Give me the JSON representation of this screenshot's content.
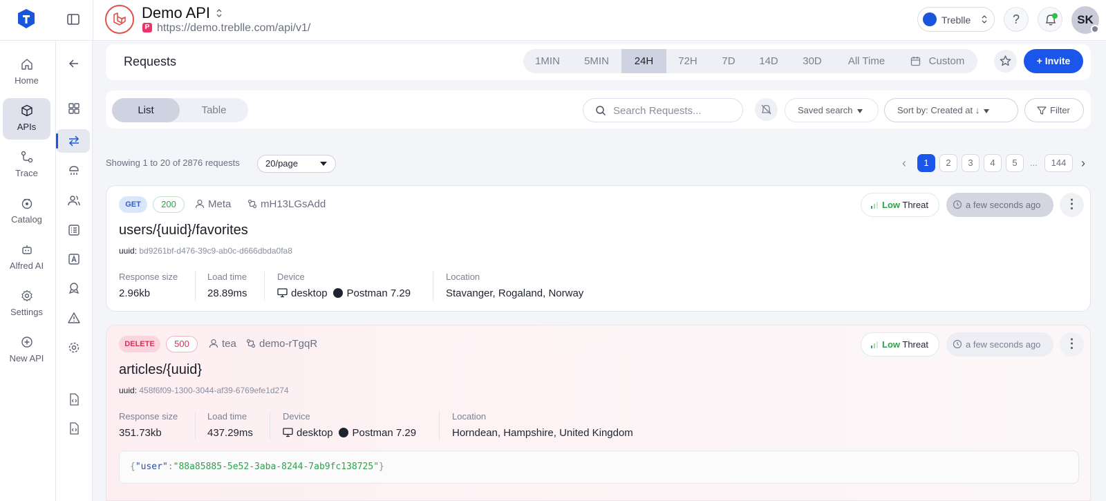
{
  "header": {
    "api_title": "Demo API",
    "api_url_badge": "P",
    "api_url": "https://demo.treblle.com/api/v1/",
    "workspace_name": "Treblle",
    "help_label": "?",
    "avatar_initials": "SK"
  },
  "sidebar": {
    "items": [
      {
        "label": "Home",
        "icon": "home-icon"
      },
      {
        "label": "APIs",
        "icon": "cube-icon"
      },
      {
        "label": "Trace",
        "icon": "trace-icon"
      },
      {
        "label": "Catalog",
        "icon": "catalog-icon"
      },
      {
        "label": "Alfred AI",
        "icon": "robot-icon"
      },
      {
        "label": "Settings",
        "icon": "gear-icon"
      },
      {
        "label": "New API",
        "icon": "plus-circle-icon"
      }
    ]
  },
  "requests": {
    "title": "Requests",
    "ranges": [
      "1MIN",
      "5MIN",
      "24H",
      "72H",
      "7D",
      "14D",
      "30D",
      "All Time",
      "Custom"
    ],
    "active_range": "24H",
    "invite_label": "+ Invite"
  },
  "toolbar": {
    "view_list": "List",
    "view_table": "Table",
    "search_placeholder": "Search Requests...",
    "saved_search": "Saved search",
    "sort_label": "Sort by: Created at ↓",
    "filter_label": "Filter"
  },
  "paging": {
    "showing": "Showing 1 to 20 of 2876 requests",
    "per_page": "20/page",
    "pages": [
      "1",
      "2",
      "3",
      "4",
      "5"
    ],
    "ellipsis": "...",
    "last_page": "144",
    "prev": "‹",
    "next": "›"
  },
  "cards": [
    {
      "method": "GET",
      "status": "200",
      "user": "Meta",
      "customer": "mH13LGsAdd",
      "endpoint": "users/{uuid}/favorites",
      "uuid_key": "uuid:",
      "uuid": "bd9261bf-d476-39c9-ab0c-d666dbda0fa8",
      "threat_level": "Low",
      "threat_word": "Threat",
      "time": "a few seconds ago",
      "response_size_label": "Response size",
      "response_size": "2.96kb",
      "load_time_label": "Load time",
      "load_time": "28.89ms",
      "device_label": "Device",
      "device": "desktop",
      "client": "Postman 7.29",
      "location_label": "Location",
      "location": "Stavanger, Rogaland, Norway"
    },
    {
      "method": "DELETE",
      "status": "500",
      "user": "tea",
      "customer": "demo-rTgqR",
      "endpoint": "articles/{uuid}",
      "uuid_key": "uuid:",
      "uuid": "458f6f09-1300-3044-af39-6769efe1d274",
      "threat_level": "Low",
      "threat_word": "Threat",
      "time": "a few seconds ago",
      "response_size_label": "Response size",
      "response_size": "351.73kb",
      "load_time_label": "Load time",
      "load_time": "437.29ms",
      "device_label": "Device",
      "device": "desktop",
      "client": "Postman 7.29",
      "location_label": "Location",
      "location": "Horndean, Hampshire, United Kingdom",
      "payload_open": "{",
      "payload_key": "\"user\"",
      "payload_colon": ":",
      "payload_value": "\"88a85885-5e52-3aba-8244-7ab9fc138725\"",
      "payload_close": "}"
    }
  ],
  "colors": {
    "accent": "#1a56ea",
    "get_badge_bg": "#dbe6fb",
    "get_badge_fg": "#2f5fc4",
    "delete_badge_bg": "#fbd5de",
    "delete_badge_fg": "#d8305a",
    "status_ok": "#2ba34a",
    "status_err": "#d8305a"
  }
}
